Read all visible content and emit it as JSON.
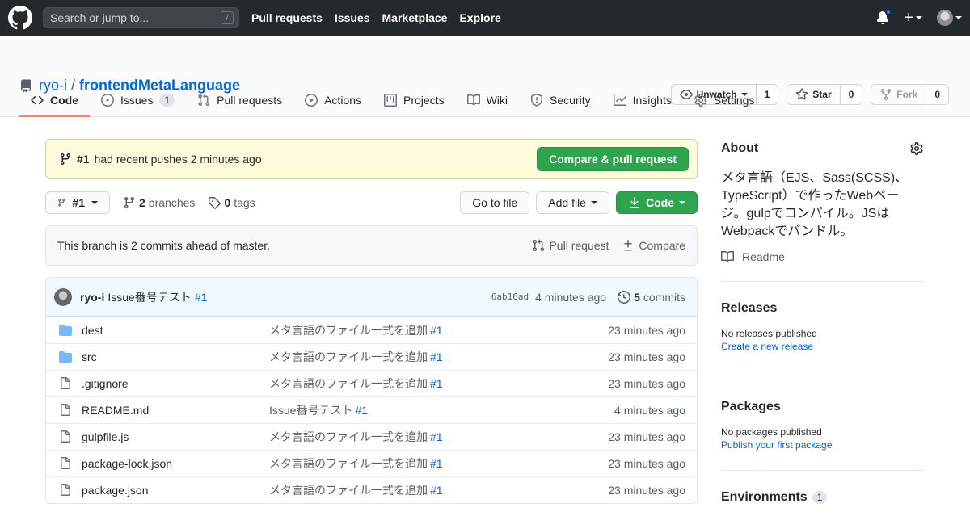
{
  "header": {
    "search_placeholder": "Search or jump to...",
    "search_shortcut": "/",
    "nav": [
      "Pull requests",
      "Issues",
      "Marketplace",
      "Explore"
    ],
    "plus_label": "+"
  },
  "repo": {
    "owner": "ryo-i",
    "separator": "/",
    "name": "frontendMetaLanguage",
    "watch_label": "Unwatch",
    "watch_count": "1",
    "star_label": "Star",
    "star_count": "0",
    "fork_label": "Fork",
    "fork_count": "0"
  },
  "tabs": [
    {
      "label": "Code",
      "selected": true
    },
    {
      "label": "Issues",
      "counter": "1"
    },
    {
      "label": "Pull requests"
    },
    {
      "label": "Actions"
    },
    {
      "label": "Projects"
    },
    {
      "label": "Wiki"
    },
    {
      "label": "Security"
    },
    {
      "label": "Insights"
    },
    {
      "label": "Settings"
    }
  ],
  "flash": {
    "branch": "#1",
    "text": "had recent pushes 2 minutes ago",
    "button": "Compare & pull request"
  },
  "toolbar": {
    "branch": "#1",
    "branches_count": "2",
    "branches_label": "branches",
    "tags_count": "0",
    "tags_label": "tags",
    "go_to_file": "Go to file",
    "add_file": "Add file",
    "code": "Code"
  },
  "ahead": {
    "text": "This branch is 2 commits ahead of master.",
    "pull_request": "Pull request",
    "compare": "Compare"
  },
  "latest_commit": {
    "author": "ryo-i",
    "message": "Issue番号テスト",
    "issue": "#1",
    "sha": "6ab16ad",
    "age": "4 minutes ago",
    "commits_count": "5",
    "commits_label": "commits"
  },
  "files": [
    {
      "name": "dest",
      "type": "dir",
      "msg": "メタ言語のファイル一式を追加",
      "ref": "#1",
      "age": "23 minutes ago"
    },
    {
      "name": "src",
      "type": "dir",
      "msg": "メタ言語のファイル一式を追加",
      "ref": "#1",
      "age": "23 minutes ago"
    },
    {
      "name": ".gitignore",
      "type": "file",
      "msg": "メタ言語のファイル一式を追加",
      "ref": "#1",
      "age": "23 minutes ago"
    },
    {
      "name": "README.md",
      "type": "file",
      "msg": "Issue番号テスト",
      "ref": "#1",
      "age": "4 minutes ago"
    },
    {
      "name": "gulpfile.js",
      "type": "file",
      "msg": "メタ言語のファイル一式を追加",
      "ref": "#1",
      "age": "23 minutes ago"
    },
    {
      "name": "package-lock.json",
      "type": "file",
      "msg": "メタ言語のファイル一式を追加",
      "ref": "#1",
      "age": "23 minutes ago"
    },
    {
      "name": "package.json",
      "type": "file",
      "msg": "メタ言語のファイル一式を追加",
      "ref": "#1",
      "age": "23 minutes ago"
    }
  ],
  "about": {
    "title": "About",
    "description": "メタ言語（EJS、Sass(SCSS)、TypeScript）で作ったWebページ。gulpでコンパイル。JSはWebpackでバンドル。",
    "readme": "Readme"
  },
  "releases": {
    "title": "Releases",
    "none": "No releases published",
    "link": "Create a new release"
  },
  "packages": {
    "title": "Packages",
    "none": "No packages published",
    "link": "Publish your first package"
  },
  "environments": {
    "title": "Environments",
    "count": "1"
  },
  "colors": {
    "header_bg": "#24292e",
    "link": "#0366d6",
    "green": "#2ea44f",
    "tab_underline": "#f9826c",
    "folder": "#79b8ff",
    "flash_bg": "#fffbdd"
  }
}
